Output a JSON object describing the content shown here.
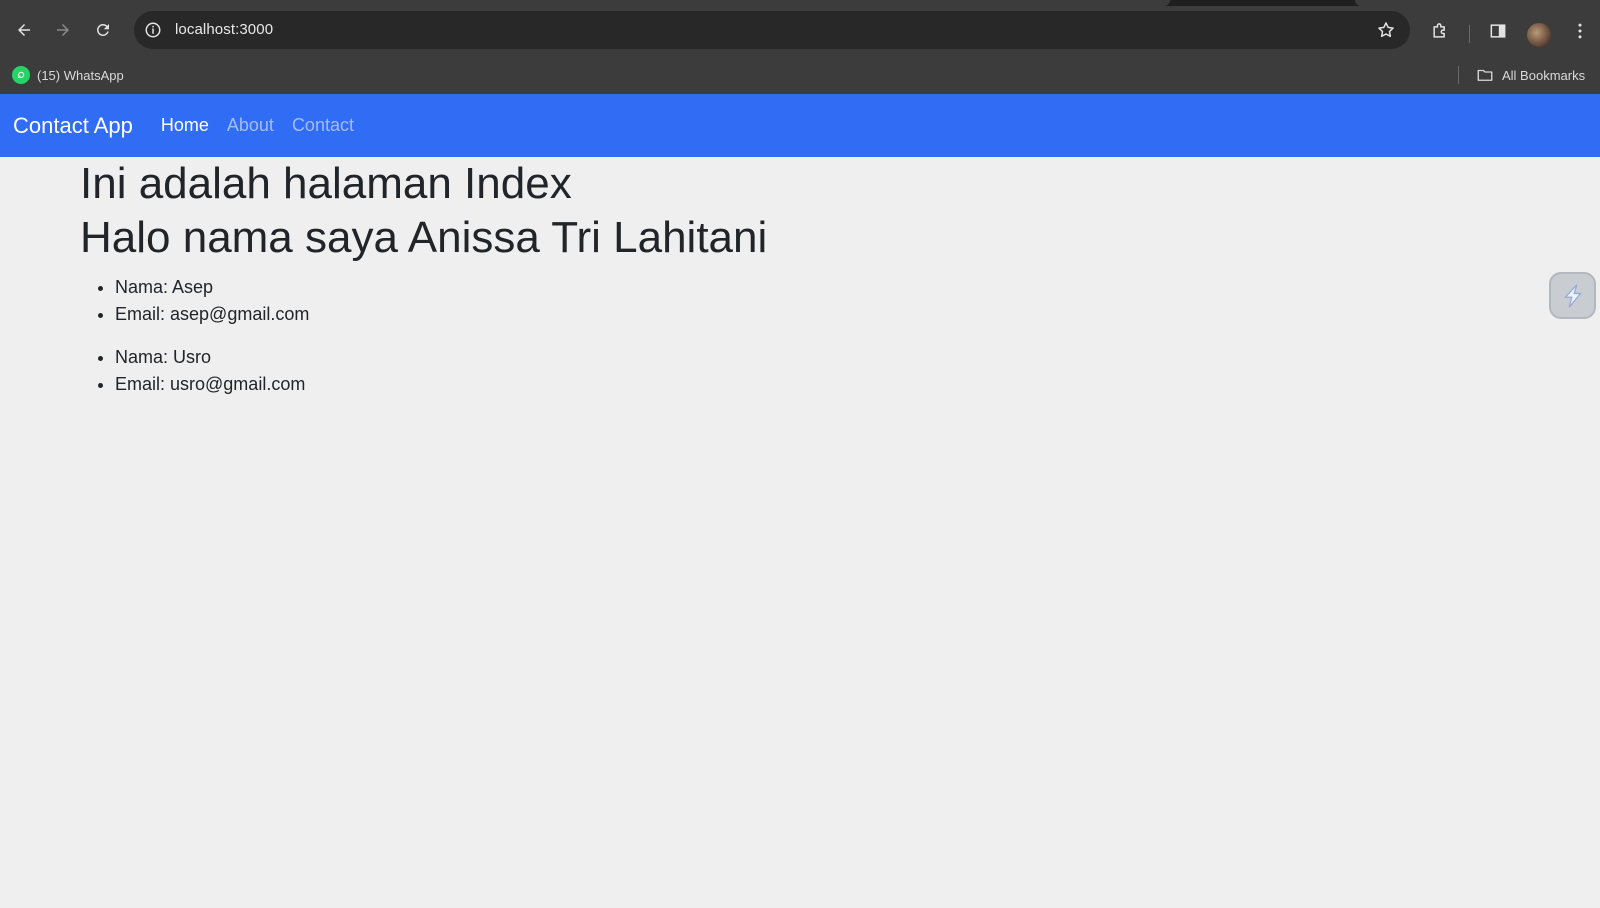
{
  "browser": {
    "url": "localhost:3000",
    "bookmarks": [
      {
        "label": "(15) WhatsApp",
        "icon": "whatsapp-icon"
      }
    ],
    "all_bookmarks_label": "All Bookmarks",
    "colors": {
      "chrome": "#3c3c3c",
      "omnibox": "#282828"
    }
  },
  "navbar": {
    "brand": "Contact App",
    "links": [
      {
        "label": "Home",
        "active": true
      },
      {
        "label": "About",
        "active": false
      },
      {
        "label": "Contact",
        "active": false
      }
    ],
    "color": "#316cf4"
  },
  "main": {
    "heading": "Ini adalah halaman Index",
    "greeting": "Halo nama saya Anissa Tri Lahitani",
    "contacts": [
      {
        "nama": "Nama: Asep",
        "email": "Email: asep@gmail.com"
      },
      {
        "nama": "Nama: Usro",
        "email": "Email: usro@gmail.com"
      }
    ]
  }
}
